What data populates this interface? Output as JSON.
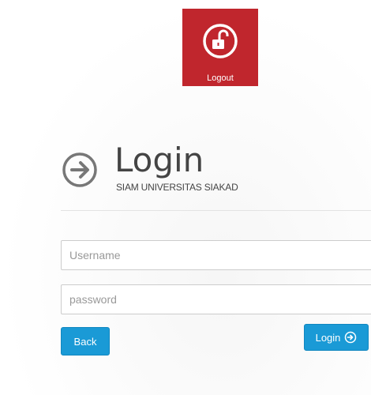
{
  "logout": {
    "label": "Logout",
    "icon": "unlock-icon",
    "color": "#c0262d"
  },
  "login": {
    "title": "Login",
    "subtitle": "SIAM UNIVERSITAS SIAKAD",
    "icon": "arrow-right-circle-icon"
  },
  "form": {
    "username_placeholder": "Username",
    "password_placeholder": "password",
    "username_value": "",
    "password_value": ""
  },
  "buttons": {
    "back_label": "Back",
    "login_label": "Login",
    "login_icon": "arrow-right-circle-icon",
    "accent": "#1a9ad6"
  }
}
